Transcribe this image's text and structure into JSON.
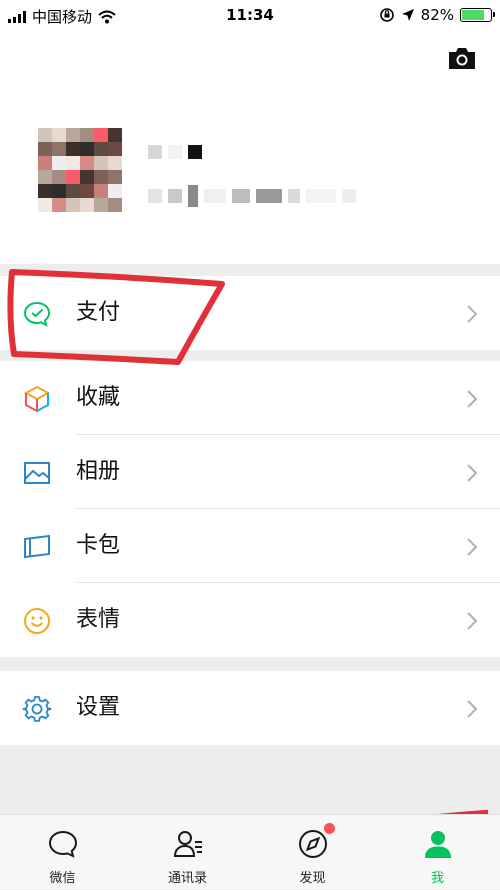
{
  "status_bar": {
    "carrier": "中国移动",
    "time": "11:34",
    "battery_percent": "82%",
    "battery_level": 0.82
  },
  "header": {
    "camera_icon": "camera-icon"
  },
  "menu": {
    "pay": {
      "label": "支付",
      "icon": "pay-icon"
    },
    "favorites": {
      "label": "收藏",
      "icon": "cube-icon"
    },
    "album": {
      "label": "相册",
      "icon": "picture-icon"
    },
    "cards": {
      "label": "卡包",
      "icon": "card-icon"
    },
    "stickers": {
      "label": "表情",
      "icon": "smiley-icon"
    },
    "settings": {
      "label": "设置",
      "icon": "gear-icon"
    }
  },
  "tabbar": {
    "tabs": [
      {
        "label": "微信",
        "icon": "chat-icon"
      },
      {
        "label": "通讯录",
        "icon": "contacts-icon"
      },
      {
        "label": "发现",
        "icon": "compass-icon",
        "badge": true
      },
      {
        "label": "我",
        "icon": "person-icon",
        "active": true
      }
    ]
  },
  "colors": {
    "accent": "#07c160",
    "badge": "#fa5151",
    "annotation": "#e0303a"
  }
}
